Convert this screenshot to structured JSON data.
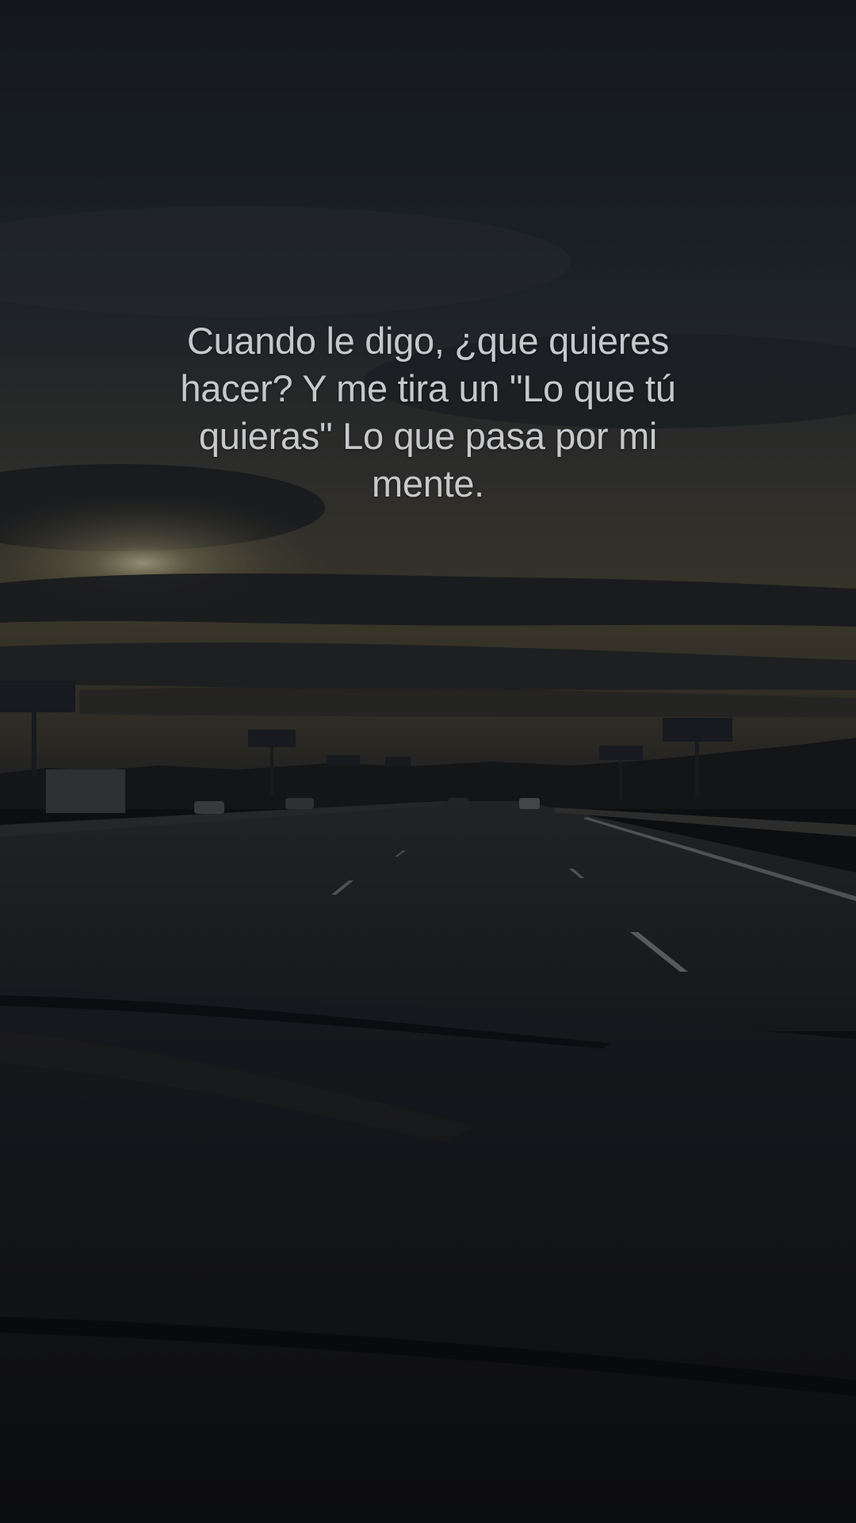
{
  "overlay": {
    "caption": "Cuando le digo, ¿que quieres hacer? Y me tira un \"Lo que tú quieras\" Lo que pasa por mi mente."
  },
  "photo": {
    "subject": "highway-sunset-through-windshield",
    "colors": {
      "sky_top": "#1c2229",
      "sky_mid": "#2b3036",
      "horizon_glow": "#6b6044",
      "sun": "#b8ae8a",
      "road": "#1f2226",
      "dashboard": "#121417",
      "text": "#c6c8cb"
    }
  }
}
